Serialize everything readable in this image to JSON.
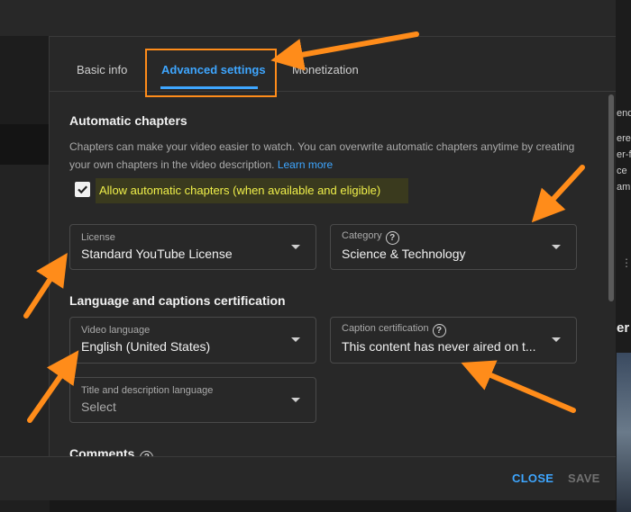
{
  "background": {
    "right_text_lines": [
      "end",
      "ere",
      "er-f",
      "ce",
      "am"
    ],
    "right_big_letter": "er"
  },
  "tabs": [
    {
      "label": "Basic info",
      "active": false
    },
    {
      "label": "Advanced settings",
      "active": true
    },
    {
      "label": "Monetization",
      "active": false
    }
  ],
  "automatic_chapters": {
    "heading": "Automatic chapters",
    "description": "Chapters can make your video easier to watch. You can overwrite automatic chapters anytime by creating your own chapters in the video description.",
    "learn_more": "Learn more",
    "checkbox_label": "Allow automatic chapters (when available and eligible)",
    "checked": true
  },
  "license": {
    "label": "License",
    "value": "Standard YouTube License"
  },
  "category": {
    "label": "Category",
    "value": "Science & Technology"
  },
  "language_section": {
    "heading": "Language and captions certification"
  },
  "video_language": {
    "label": "Video language",
    "value": "English (United States)"
  },
  "caption_certification": {
    "label": "Caption certification",
    "value": "This content has never aired on t..."
  },
  "title_language": {
    "label": "Title and description language",
    "value": "Select"
  },
  "comments": {
    "heading": "Comments"
  },
  "footer": {
    "close": "CLOSE",
    "save": "SAVE"
  },
  "colors": {
    "accent": "#3ea6ff",
    "annotation": "#ff8c1a",
    "highlight_text": "#f0f04a"
  }
}
